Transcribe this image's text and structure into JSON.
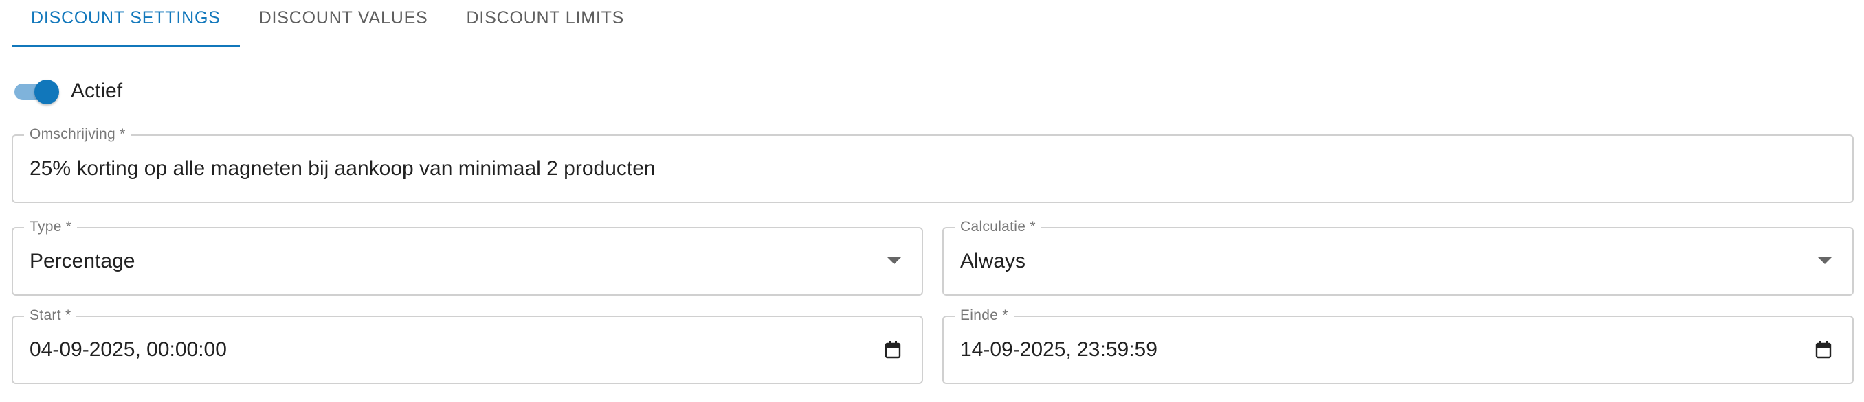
{
  "tabs": [
    {
      "label": "DISCOUNT SETTINGS",
      "active": true
    },
    {
      "label": "DISCOUNT VALUES",
      "active": false
    },
    {
      "label": "DISCOUNT LIMITS",
      "active": false
    }
  ],
  "active_toggle": {
    "label": "Actief",
    "checked": true
  },
  "form": {
    "omschrijving": {
      "label": "Omschrijving *",
      "value": "25% korting op alle magneten bij aankoop van minimaal 2 producten"
    },
    "type": {
      "label": "Type *",
      "value": "Percentage",
      "icon": "caret-down-icon"
    },
    "calculatie": {
      "label": "Calculatie *",
      "value": "Always",
      "icon": "caret-down-icon"
    },
    "start": {
      "label": "Start *",
      "value": "04-09-2025, 00:00:00",
      "icon": "calendar-icon"
    },
    "einde": {
      "label": "Einde *",
      "value": "14-09-2025, 23:59:59",
      "icon": "calendar-icon"
    }
  },
  "colors": {
    "accent": "#1177bb",
    "switch_track": "#7fb3db",
    "border": "#d0d0d0",
    "tab_text": "#5f5f5f",
    "label_text": "#777777"
  }
}
